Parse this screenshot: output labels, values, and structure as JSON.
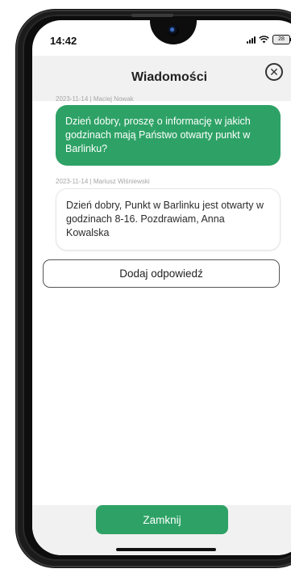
{
  "status_bar": {
    "time": "14:42",
    "battery": "28",
    "icons": [
      "signal-icon",
      "wifi-icon",
      "battery-icon"
    ]
  },
  "header": {
    "title": "Wiadomości",
    "close_icon": "close-circle-icon"
  },
  "messages": [
    {
      "meta": "2023-11-14 | Maciej Nowak",
      "text": "Dzień dobry, proszę o informację w jakich godzinach mają Państwo otwarty punkt w Barlinku?",
      "direction": "sent"
    },
    {
      "meta": "2023-11-14 | Mariusz Wiśniewski",
      "text": "Dzień dobry, Punkt w Barlinku jest otwarty w godzinach 8-16. Pozdrawiam, Anna Kowalska",
      "direction": "received"
    }
  ],
  "actions": {
    "reply_label": "Dodaj odpowiedź",
    "close_label": "Zamknij"
  },
  "colors": {
    "accent_green": "#2ea266",
    "header_bg": "#f1f1f1"
  }
}
